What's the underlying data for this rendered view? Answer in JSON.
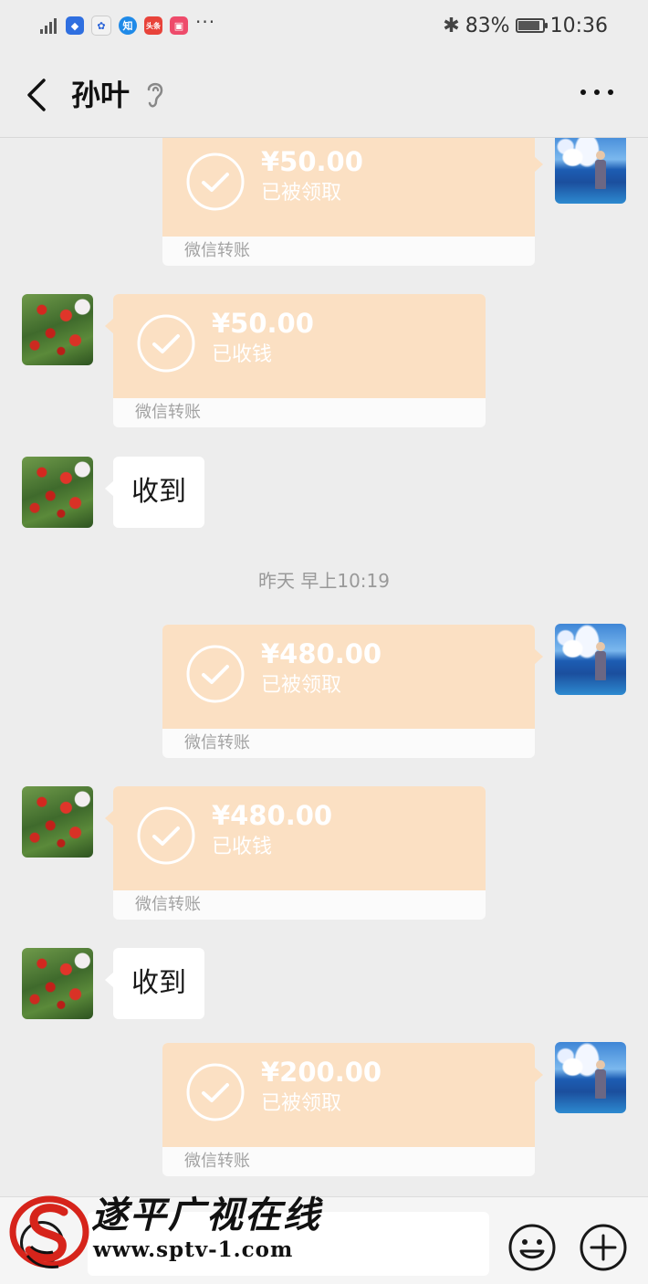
{
  "status_bar": {
    "signal_label": "8ᶜ",
    "battery": "83%",
    "time": "10:36",
    "app_icons": [
      "shield-app-icon",
      "baidu-app-icon",
      "zhihu-app-icon",
      "toutiao-app-icon",
      "weibo-app-icon"
    ],
    "battery_level": 0.83
  },
  "header": {
    "contact_name": "孙叶"
  },
  "chat": {
    "transfer_footer": "微信转账",
    "reply_text": "收到",
    "timestamp": "昨天 早上10:19",
    "transfers": [
      {
        "direction": "sent",
        "amount": "¥50.00",
        "status": "已被领取"
      },
      {
        "direction": "received",
        "amount": "¥50.00",
        "status": "已收钱"
      },
      {
        "direction": "sent",
        "amount": "¥480.00",
        "status": "已被领取"
      },
      {
        "direction": "received",
        "amount": "¥480.00",
        "status": "已收钱"
      },
      {
        "direction": "sent",
        "amount": "¥200.00",
        "status": "已被领取"
      }
    ]
  },
  "watermark": {
    "title": "遂平广视在线",
    "url": "www.sptv-1.com"
  },
  "colors": {
    "background": "#ededed",
    "transfer_orange": "#fbe0c3",
    "bubble_white": "#ffffff"
  }
}
